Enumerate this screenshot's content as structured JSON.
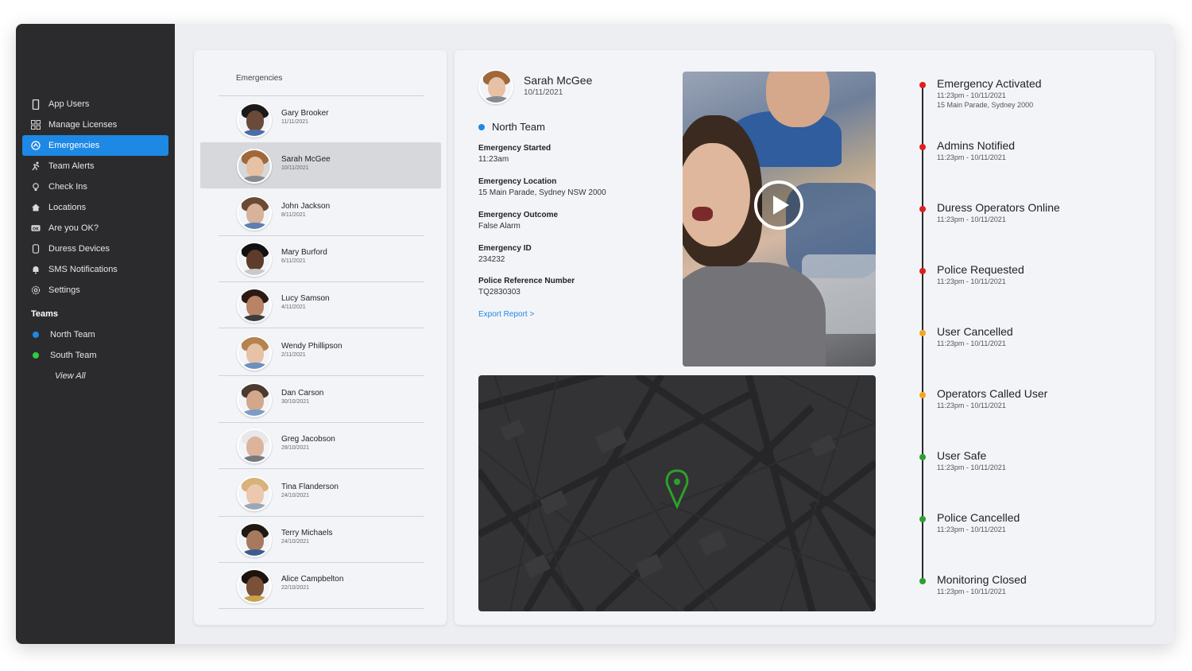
{
  "sidebar": {
    "items": [
      {
        "label": "App Users",
        "icon": "phone-icon",
        "active": false
      },
      {
        "label": "Manage Licenses",
        "icon": "grid-icon",
        "active": false
      },
      {
        "label": "Emergencies",
        "icon": "emergency-icon",
        "active": true
      },
      {
        "label": "Team Alerts",
        "icon": "running-person-icon",
        "active": false
      },
      {
        "label": "Check Ins",
        "icon": "lightbulb-icon",
        "active": false
      },
      {
        "label": "Locations",
        "icon": "home-icon",
        "active": false
      },
      {
        "label": "Are you OK?",
        "icon": "ok-badge-icon",
        "active": false
      },
      {
        "label": "Duress Devices",
        "icon": "device-icon",
        "active": false
      },
      {
        "label": "SMS Notifications",
        "icon": "bell-icon",
        "active": false
      },
      {
        "label": "Settings",
        "icon": "gear-icon",
        "active": false
      }
    ],
    "teams_heading": "Teams",
    "teams": [
      {
        "label": "North Team",
        "color": "#1e88e5"
      },
      {
        "label": "South Team",
        "color": "#2ecc40"
      }
    ],
    "view_all": "View All"
  },
  "emergencies": {
    "title": "Emergencies",
    "rows": [
      {
        "name": "Gary Brooker",
        "date": "11/11/2021",
        "selected": false
      },
      {
        "name": "Sarah McGee",
        "date": "10/11/2021",
        "selected": true
      },
      {
        "name": "John Jackson",
        "date": "8/11/2021",
        "selected": false
      },
      {
        "name": "Mary Burford",
        "date": "6/11/2021",
        "selected": false
      },
      {
        "name": "Lucy Samson",
        "date": "4/11/2021",
        "selected": false
      },
      {
        "name": "Wendy Phillipson",
        "date": "2/11/2021",
        "selected": false
      },
      {
        "name": "Dan Carson",
        "date": "30/10/2021",
        "selected": false
      },
      {
        "name": "Greg Jacobson",
        "date": "28/10/2021",
        "selected": false
      },
      {
        "name": "Tina Flanderson",
        "date": "24/10/2021",
        "selected": false
      },
      {
        "name": "Terry Michaels",
        "date": "24/10/2021",
        "selected": false
      },
      {
        "name": "Alice Campbelton",
        "date": "22/10/2021",
        "selected": false
      }
    ]
  },
  "detail": {
    "name": "Sarah McGee",
    "date": "10/11/2021",
    "team": "North Team",
    "fields": [
      {
        "label": "Emergency Started",
        "value": "11:23am"
      },
      {
        "label": "Emergency Location",
        "value": "15 Main Parade, Sydney NSW 2000"
      },
      {
        "label": "Emergency Outcome",
        "value": "False Alarm"
      },
      {
        "label": "Emergency ID",
        "value": "234232"
      },
      {
        "label": "Police Reference Number",
        "value": "TQ2830303"
      }
    ],
    "export_link": "Export Report >",
    "video_icon": "play-icon",
    "map_icon": "map-pin-icon"
  },
  "timeline": [
    {
      "title": "Emergency Activated",
      "time": "11:23pm - 10/11/2021",
      "address": "15 Main Parade, Sydney 2000",
      "color": "#e01e1e"
    },
    {
      "title": "Admins Notified",
      "time": "11:23pm - 10/11/2021",
      "color": "#e01e1e"
    },
    {
      "title": "Duress Operators Online",
      "time": "11:23pm - 10/11/2021",
      "color": "#e01e1e"
    },
    {
      "title": "Police Requested",
      "time": "11:23pm - 10/11/2021",
      "color": "#e01e1e"
    },
    {
      "title": "User Cancelled",
      "time": "11:23pm - 10/11/2021",
      "color": "#f5a623"
    },
    {
      "title": "Operators Called User",
      "time": "11:23pm - 10/11/2021",
      "color": "#f5a623"
    },
    {
      "title": "User Safe",
      "time": "11:23pm - 10/11/2021",
      "color": "#2ca02c"
    },
    {
      "title": "Police Cancelled",
      "time": "11:23pm - 10/11/2021",
      "color": "#2ca02c"
    },
    {
      "title": "Monitoring Closed",
      "time": "11:23pm - 10/11/2021",
      "color": "#2ca02c"
    }
  ]
}
